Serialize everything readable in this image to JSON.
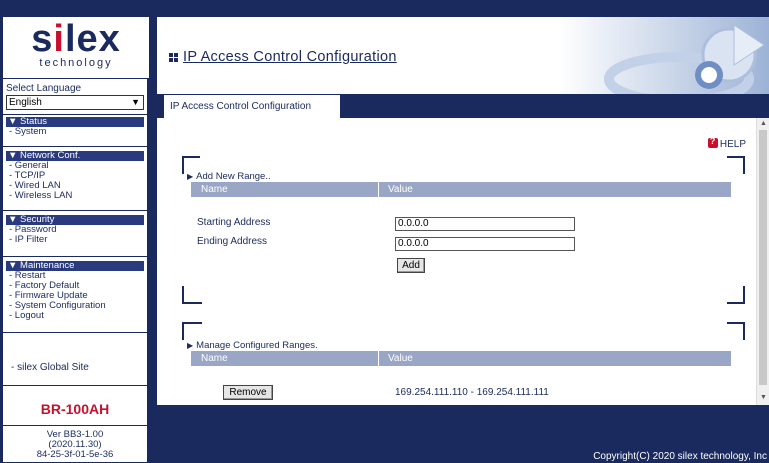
{
  "brand": {
    "logo_text_pre": "s",
    "logo_text_i": "i",
    "logo_text_post": "lex",
    "logo_sub": "technology"
  },
  "sidebar": {
    "language_label": "Select Language",
    "language_value": "English",
    "sections": [
      {
        "head": "▼ Status",
        "items": [
          "- System"
        ]
      },
      {
        "head": "▼ Network Conf.",
        "items": [
          "- General",
          "- TCP/IP",
          "- Wired LAN",
          "- Wireless LAN"
        ]
      },
      {
        "head": "▼ Security",
        "items": [
          "- Password",
          "- IP Filter"
        ]
      },
      {
        "head": "▼ Maintenance",
        "items": [
          "- Restart",
          "- Factory Default",
          "- Firmware Update",
          "- System Configuration",
          "- Logout"
        ]
      }
    ],
    "global_link": "- silex Global Site",
    "model": "BR-100AH",
    "version_lines": [
      "Ver BB3-1.00",
      "(2020.11.30)",
      "84-25-3f-01-5e-36"
    ]
  },
  "header": {
    "title": "IP Access Control Configuration"
  },
  "tab": {
    "label": "IP Access Control Configuration"
  },
  "help": {
    "label": "HELP"
  },
  "add_range": {
    "title": "Add New Range..",
    "col_name": "Name",
    "col_value": "Value",
    "start_label": "Starting Address",
    "start_value": "0.0.0.0",
    "end_label": "Ending Address",
    "end_value": "0.0.0.0",
    "add_button": "Add"
  },
  "manage_ranges": {
    "title": "Manage Configured Ranges.",
    "col_name": "Name",
    "col_value": "Value",
    "rows": [
      {
        "button": "Remove",
        "value": "169.254.111.110 - 169.254.111.111"
      }
    ]
  },
  "footer": {
    "copyright": "Copyright(C) 2020 silex technology, Inc"
  },
  "colors": {
    "navy": "#1a2a5e",
    "accent_red": "#c8102e",
    "grid_header": "#9aa6c6"
  }
}
